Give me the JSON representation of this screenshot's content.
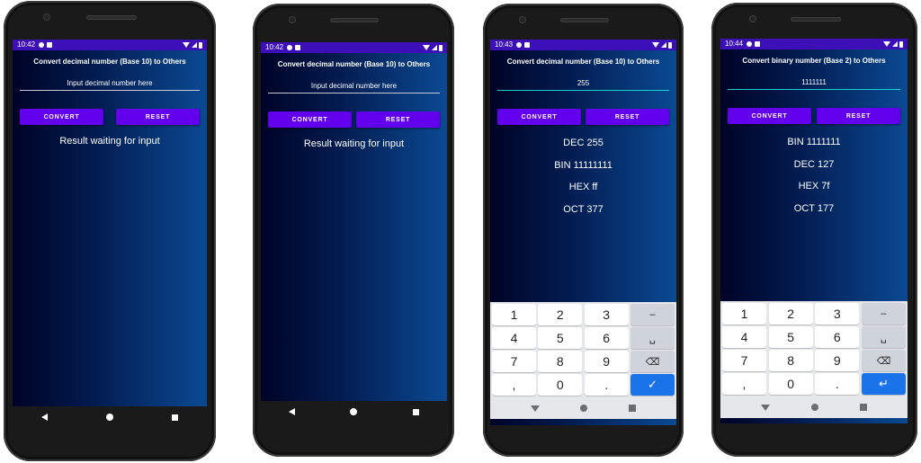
{
  "status": {
    "times": [
      "10:42",
      "10:42",
      "10:43",
      "10:44"
    ]
  },
  "screens": [
    {
      "title": "Convert decimal number (Base 10) to Others",
      "input_placeholder": "Input decimal number here",
      "input_value": "",
      "convert_label": "CONVERT",
      "reset_label": "RESET",
      "result_placeholder": "Result waiting for input"
    },
    {
      "title": "Convert decimal number (Base 10) to Others",
      "input_placeholder": "Input decimal number here",
      "input_value": "",
      "convert_label": "CONVERT",
      "reset_label": "RESET",
      "result_placeholder": "Result waiting for input"
    },
    {
      "title": "Convert decimal number (Base 10) to Others",
      "input_value": "255",
      "convert_label": "CONVERT",
      "reset_label": "RESET",
      "results": [
        "DEC 255",
        "BIN 11111111",
        "HEX ff",
        "OCT 377"
      ],
      "keyboard": {
        "rows": [
          [
            "1",
            "2",
            "3",
            "–"
          ],
          [
            "4",
            "5",
            "6",
            "␣"
          ],
          [
            "7",
            "8",
            "9",
            "⌫"
          ],
          [
            ",",
            "0",
            ".",
            "✓"
          ]
        ]
      }
    },
    {
      "title": "Convert binary number (Base 2) to Others",
      "input_value": "1111111",
      "convert_label": "CONVERT",
      "reset_label": "RESET",
      "results": [
        "BIN 1111111",
        "DEC 127",
        "HEX 7f",
        "OCT 177"
      ],
      "keyboard": {
        "rows": [
          [
            "1",
            "2",
            "3",
            "–"
          ],
          [
            "4",
            "5",
            "6",
            "␣"
          ],
          [
            "7",
            "8",
            "9",
            "⌫"
          ],
          [
            ",",
            "0",
            ".",
            "↵"
          ]
        ]
      }
    }
  ]
}
